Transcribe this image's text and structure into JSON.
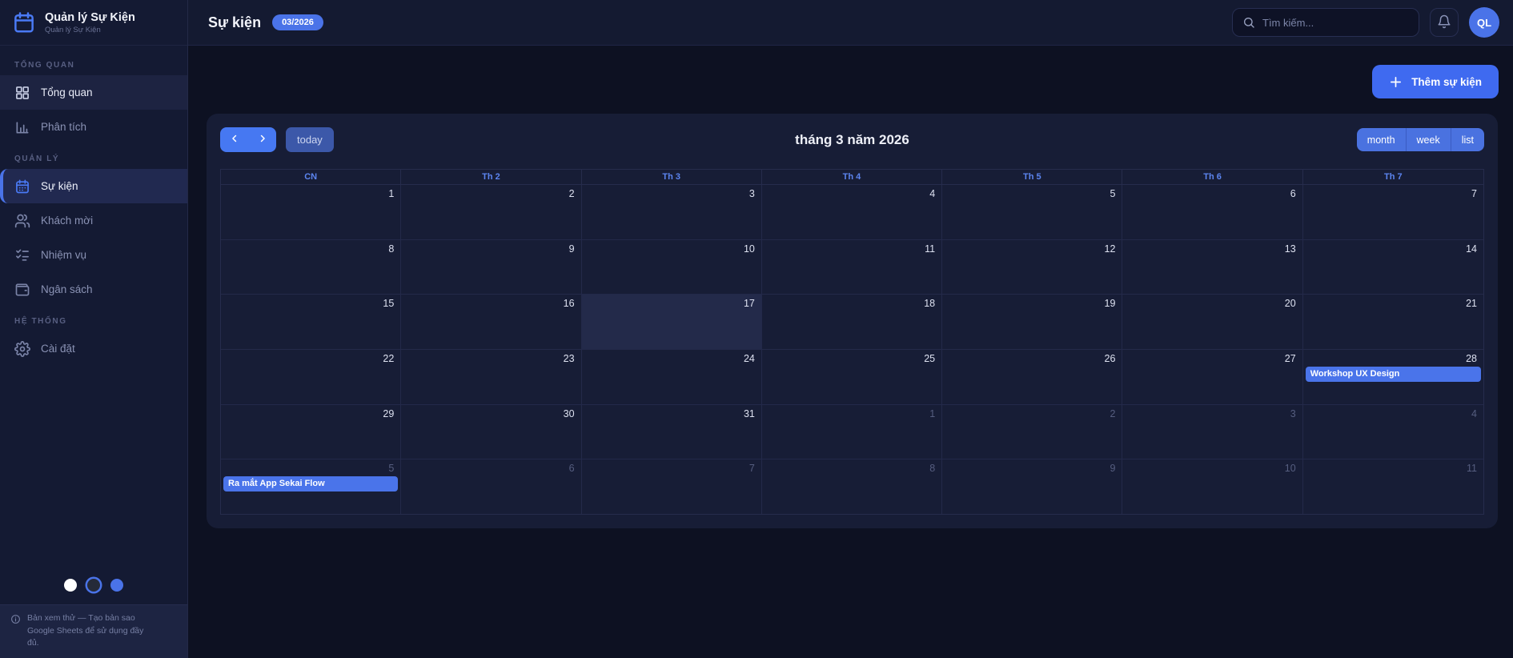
{
  "app": {
    "title": "Quản lý Sự Kiện",
    "subtitle": "Quản lý Sự Kiện"
  },
  "sidebar": {
    "sections": [
      {
        "label": "TỔNG QUAN",
        "items": [
          {
            "label": "Tổng quan",
            "icon": "dashboard-icon",
            "state": "highlight"
          },
          {
            "label": "Phân tích",
            "icon": "analytics-icon",
            "state": "normal"
          }
        ]
      },
      {
        "label": "QUẢN LÝ",
        "items": [
          {
            "label": "Sự kiện",
            "icon": "calendar-icon",
            "state": "active"
          },
          {
            "label": "Khách mời",
            "icon": "guests-icon",
            "state": "normal"
          },
          {
            "label": "Nhiệm vụ",
            "icon": "tasks-icon",
            "state": "normal"
          },
          {
            "label": "Ngân sách",
            "icon": "budget-icon",
            "state": "normal"
          }
        ]
      },
      {
        "label": "HỆ THỐNG",
        "items": [
          {
            "label": "Cài đặt",
            "icon": "settings-icon",
            "state": "normal"
          }
        ]
      }
    ],
    "theme_dots": [
      {
        "name": "light",
        "color": "#ffffff",
        "selected": false
      },
      {
        "name": "dark",
        "color": "#252a38",
        "selected": true
      },
      {
        "name": "blue",
        "color": "#4a73e8",
        "selected": false
      }
    ],
    "footer": "Bản xem thử — Tạo bản sao Google Sheets để sử dụng đầy đủ."
  },
  "topbar": {
    "title": "Sự kiện",
    "badge": "03/2026",
    "search_placeholder": "Tìm kiếm...",
    "avatar_initials": "QL"
  },
  "main": {
    "add_event_label": "Thêm sự kiện"
  },
  "calendar": {
    "title": "tháng 3 năm 2026",
    "today_label": "today",
    "views": [
      "month",
      "week",
      "list"
    ],
    "day_headers": [
      "CN",
      "Th 2",
      "Th 3",
      "Th 4",
      "Th 5",
      "Th 6",
      "Th 7"
    ],
    "weeks": [
      [
        {
          "d": 1
        },
        {
          "d": 2
        },
        {
          "d": 3
        },
        {
          "d": 4
        },
        {
          "d": 5
        },
        {
          "d": 6
        },
        {
          "d": 7
        }
      ],
      [
        {
          "d": 8
        },
        {
          "d": 9
        },
        {
          "d": 10
        },
        {
          "d": 11
        },
        {
          "d": 12
        },
        {
          "d": 13
        },
        {
          "d": 14
        }
      ],
      [
        {
          "d": 15
        },
        {
          "d": 16
        },
        {
          "d": 17,
          "today": true
        },
        {
          "d": 18
        },
        {
          "d": 19
        },
        {
          "d": 20
        },
        {
          "d": 21
        }
      ],
      [
        {
          "d": 22
        },
        {
          "d": 23
        },
        {
          "d": 24
        },
        {
          "d": 25
        },
        {
          "d": 26
        },
        {
          "d": 27
        },
        {
          "d": 28,
          "event": "Workshop UX Design"
        }
      ],
      [
        {
          "d": 29
        },
        {
          "d": 30
        },
        {
          "d": 31
        },
        {
          "d": 1,
          "other": true
        },
        {
          "d": 2,
          "other": true
        },
        {
          "d": 3,
          "other": true
        },
        {
          "d": 4,
          "other": true
        }
      ],
      [
        {
          "d": 5,
          "other": true,
          "event": "Ra mắt App Sekai Flow"
        },
        {
          "d": 6,
          "other": true
        },
        {
          "d": 7,
          "other": true
        },
        {
          "d": 8,
          "other": true
        },
        {
          "d": 9,
          "other": true
        },
        {
          "d": 10,
          "other": true
        },
        {
          "d": 11,
          "other": true
        }
      ]
    ],
    "events": [
      {
        "title": "Workshop UX Design",
        "date": "28/03/2026"
      },
      {
        "title": "Ra mắt App Sekai Flow",
        "date": "05/04/2026"
      }
    ],
    "colors": {
      "accent": "#4a73e8",
      "event_bg": "#4a74ea",
      "today_cell_bg": "#232a4a",
      "day_header_text": "#5c85f0"
    }
  }
}
